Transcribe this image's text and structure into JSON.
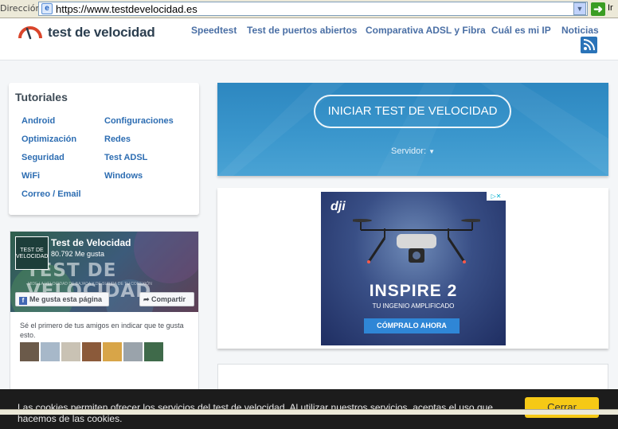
{
  "browser": {
    "address_label": "Dirección",
    "url": "https://www.testdevelocidad.es",
    "go_label": "Ir"
  },
  "site": {
    "logo_text": "test de velocidad",
    "nav": [
      "Speedtest",
      "Test de puertos abiertos",
      "Comparativa ADSL y Fibra",
      "Cuál es mi IP",
      "Noticias"
    ],
    "rss_icon": "rss-icon"
  },
  "tutorials": {
    "title": "Tutoriales",
    "col1": [
      "Android",
      "Optimización",
      "Seguridad",
      "WiFi",
      "Correo / Email"
    ],
    "col2": [
      "Configuraciones",
      "Redes",
      "Test ADSL",
      "Windows"
    ]
  },
  "facebook": {
    "page_name": "Test de Velocidad",
    "likes": "80.792 Me gusta",
    "avatar_text": "TEST DE VELOCIDAD",
    "cover_text": "TEST DE VELOCIDAD",
    "cover_sub": "MIDE LA VELOCIDAD DE BAJADA Y DE SUBIDA DE TU CONEXIÓN",
    "like_button": "Me gusta esta página",
    "share_button": "Compartir",
    "first_friend": "Sé el primero de tus amigos en indicar que te gusta esto."
  },
  "speedtest": {
    "start_button": "INICIAR TEST DE VELOCIDAD",
    "server_label": "Servidor:"
  },
  "ad": {
    "brand": "dji",
    "title": "INSPIRE 2",
    "subtitle": "TU INGENIO AMPLIFICADO",
    "cta": "CÓMPRALO AHORA"
  },
  "cookie": {
    "text": "Las cookies permiten ofrecer los servicios del test de velocidad. Al utilizar nuestros servicios, aceptas el uso que hacemos de las cookies.",
    "button": "Cerrar"
  },
  "colors": {
    "accent_blue": "#3a96cc",
    "link_blue": "#2d6db2",
    "cookie_button": "#f6c916",
    "logo_red": "#d9452b"
  }
}
